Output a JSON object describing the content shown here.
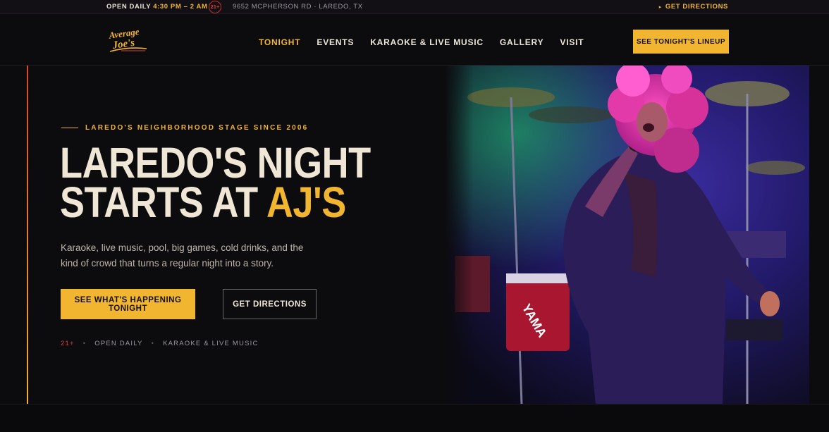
{
  "topbar": {
    "open_label": "OPEN DAILY",
    "hours": "4:30 PM – 2 AM",
    "age_badge": "21+",
    "address": "9652 MCPHERSON RD · LAREDO, TX",
    "directions_link": "GET DIRECTIONS"
  },
  "header": {
    "logo_alt": "Average Joe's",
    "nav": {
      "tonight": "TONIGHT",
      "events": "EVENTS",
      "karaoke": "KARAOKE & LIVE MUSIC",
      "gallery": "GALLERY",
      "visit": "VISIT"
    },
    "cta": "SEE TONIGHT'S LINEUP"
  },
  "hero": {
    "eyebrow": "LAREDO'S NEIGHBORHOOD STAGE SINCE 2006",
    "headline_line1": "LAREDO'S NIGHT",
    "headline_line2_prefix": "STARTS AT ",
    "headline_highlight": "AJ'S",
    "lede": "Karaoke, live music, pool, big games, cold drinks, and the kind of crowd that turns a regular night into a story.",
    "primary_button": "SEE WHAT'S HAPPENING TONIGHT",
    "secondary_button": "GET DIRECTIONS",
    "tags": {
      "age": "21+",
      "open": "OPEN DAILY",
      "music": "KARAOKE & LIVE MUSIC"
    }
  },
  "colors": {
    "accent": "#f1b530",
    "alert_red": "#d6403a",
    "background": "#0c0b0e",
    "text_light": "#efe6d5"
  },
  "icons": {
    "age_badge": "age-21-circle-icon",
    "directions": "triangle-right-icon"
  }
}
